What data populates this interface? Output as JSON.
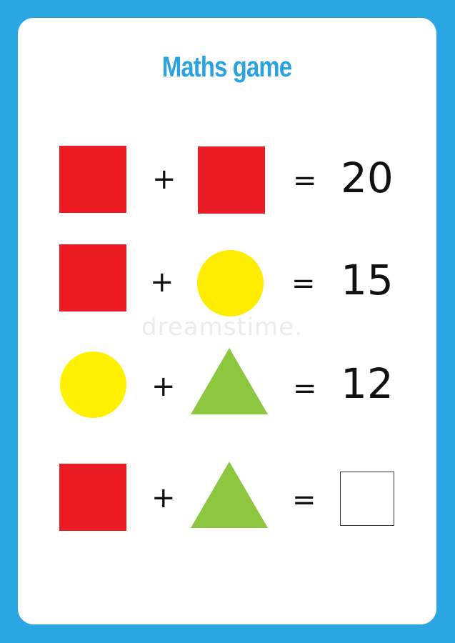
{
  "page": {
    "title": "Maths game",
    "watermark": "dreamstime.",
    "colors": {
      "border": "#2aa7e3",
      "title": "#2aa2e0",
      "square": "#ec1c24",
      "circle": "#ffed00",
      "triangle": "#8dc63f"
    }
  },
  "equations": [
    {
      "left": "red-square",
      "operator": "+",
      "right": "red-square",
      "equals": "=",
      "result": "20"
    },
    {
      "left": "red-square",
      "operator": "+",
      "right": "yellow-circle",
      "equals": "=",
      "result": "15"
    },
    {
      "left": "yellow-circle",
      "operator": "+",
      "right": "green-triangle",
      "equals": "=",
      "result": "12"
    },
    {
      "left": "red-square",
      "operator": "+",
      "right": "green-triangle",
      "equals": "=",
      "result": ""
    }
  ]
}
